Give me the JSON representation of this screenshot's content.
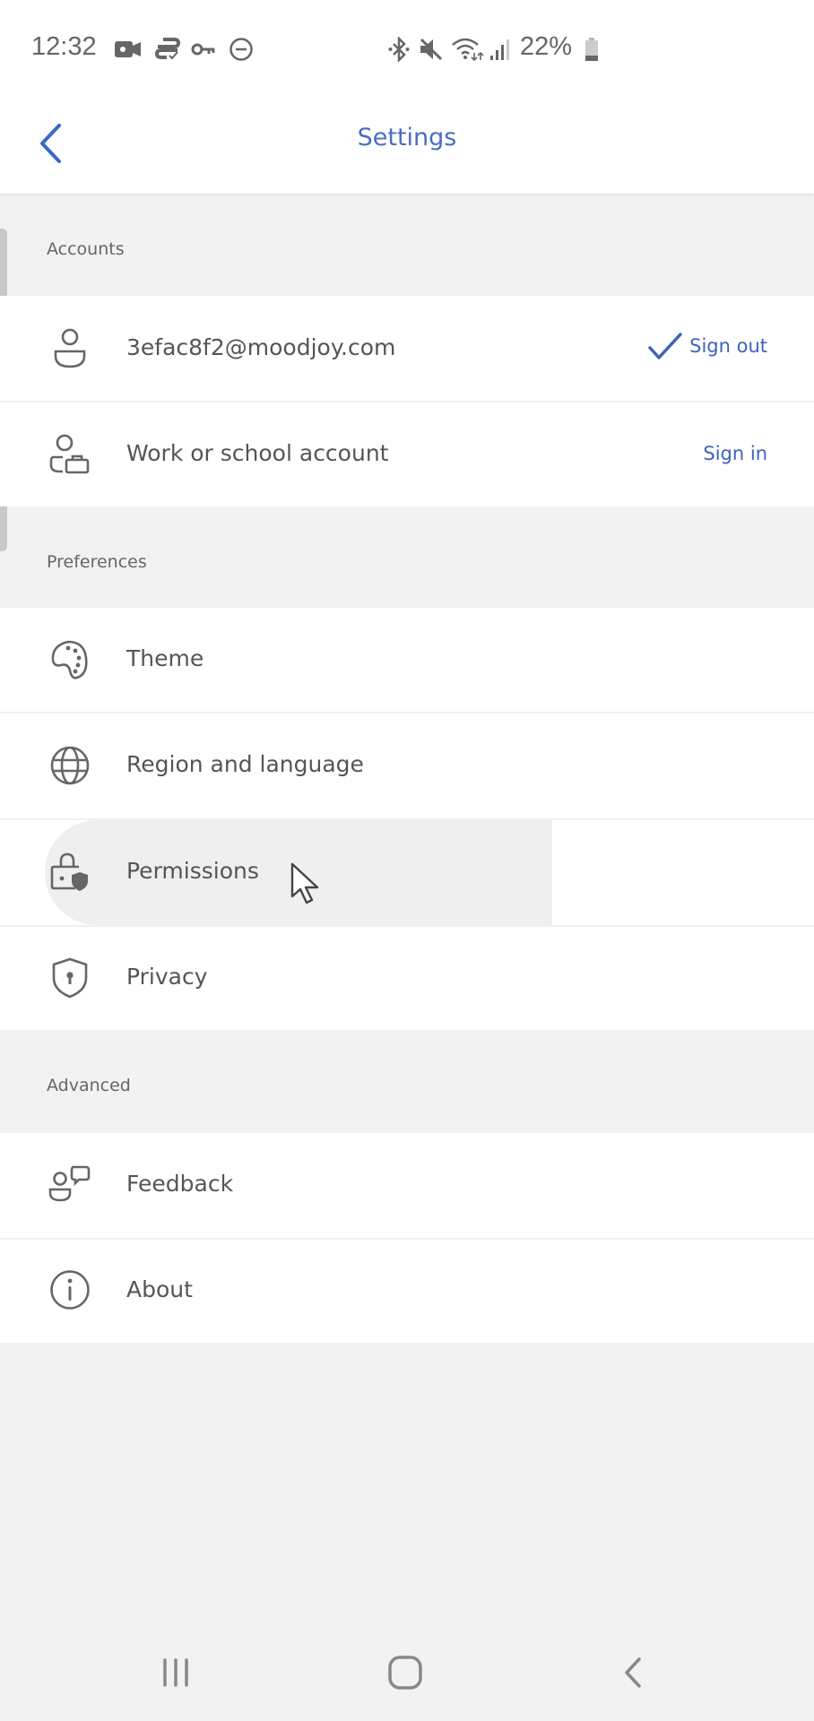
{
  "status_bar": {
    "time": "12:32",
    "left_icons": [
      "video-camera-icon",
      "sync-data-icon",
      "vpn-key-icon",
      "do-not-disturb-icon"
    ],
    "right_icons": [
      "bluetooth-icon",
      "mute-icon",
      "wifi-icon",
      "signal-icon",
      "battery-icon"
    ],
    "battery_percent": "22%"
  },
  "header": {
    "title": "Settings",
    "back_icon": "chevron-left-icon"
  },
  "colors": {
    "accent": "#3d63b8",
    "title": "#4a6ec0",
    "background": "#f2f2f2",
    "row_background": "#ffffff",
    "text": "#555555"
  },
  "sections": [
    {
      "label": "Accounts",
      "items": [
        {
          "icon": "person-icon",
          "label": "3efac8f2@moodjoy.com",
          "action": "Sign out",
          "checked": true
        },
        {
          "icon": "work-account-icon",
          "label": "Work or school account",
          "action": "Sign in"
        }
      ]
    },
    {
      "label": "Preferences",
      "items": [
        {
          "icon": "palette-icon",
          "label": "Theme"
        },
        {
          "icon": "globe-icon",
          "label": "Region and language"
        },
        {
          "icon": "lock-shield-icon",
          "label": "Permissions",
          "pressed": true
        },
        {
          "icon": "shield-keyhole-icon",
          "label": "Privacy"
        }
      ]
    },
    {
      "label": "Advanced",
      "items": [
        {
          "icon": "feedback-icon",
          "label": "Feedback"
        },
        {
          "icon": "info-icon",
          "label": "About"
        }
      ]
    }
  ],
  "nav_bar": {
    "buttons": [
      "recents-icon",
      "home-icon",
      "back-icon"
    ]
  }
}
